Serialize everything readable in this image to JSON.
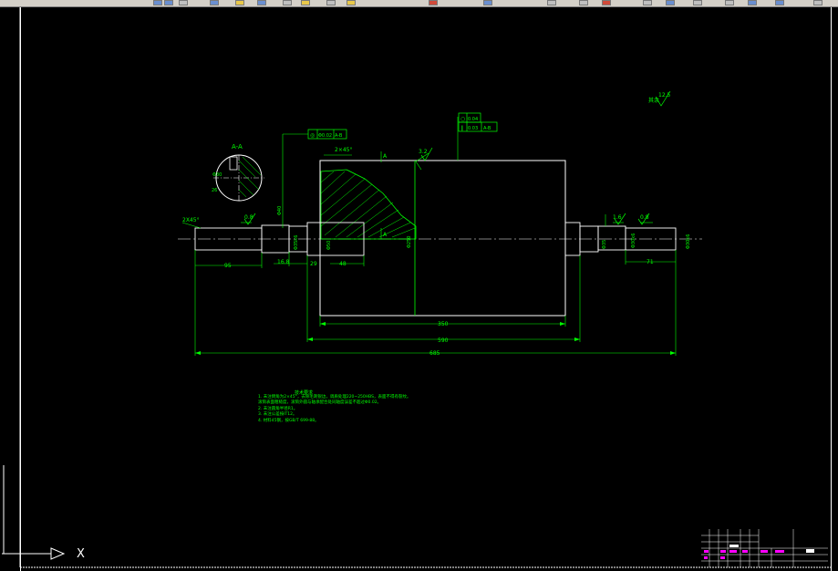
{
  "drawing": {
    "section_label": "A-A",
    "chamfer_left": "2X45°",
    "chamfer_roller": "2×45°",
    "roughness_top": "3.2",
    "roughness_corner": "12.5",
    "roughness_corner_prefix": "其余",
    "roughness_left_journal": "0.8",
    "roughness_right_journal": "0.8",
    "roughness_right_mid": "1.6",
    "section_marker_a_top": "A",
    "section_marker_a_bottom": "A",
    "tolerance_left": {
      "symbol": "◎",
      "value": "Φ0.02",
      "datum": "A-B"
    },
    "tolerance_top_1": {
      "symbol": "○",
      "value": "0.04"
    },
    "tolerance_top_2": {
      "symbol": "∥",
      "value": "0.03",
      "datum": "A-B"
    },
    "dim_95": "95",
    "dim_168": "16.8",
    "dim_29": "29",
    "dim_48": "48",
    "dim_350": "350",
    "dim_590": "590",
    "dim_685": "685",
    "dim_71": "71",
    "dim_roller_dia": "Φ250",
    "dim_right_end": "Φ30k6",
    "dim_section_dia": "Φ30",
    "dim_section_key": "26",
    "dim_left_shaft": "Φ35k6",
    "dim_left_mid": "Φ40",
    "dim_left_flange": "Φ50",
    "dim_right_mid": "Φ35",
    "dim_right_journal": "Φ30k6"
  },
  "notes": {
    "title": "技术要求",
    "lines": [
      "1. 未注倒角为2×45°，去除毛刺锐边，调质处理220~250HBS，表面不得有裂纹。",
      "   滚筒表面粗糙度，滚筒外圆与轴承配合处同轴度误差不超过Φ0.02。",
      "2. 未注圆角半径R1。",
      "3. 未注公差按IT12。",
      "4. 材料45钢，按GB/T 699-88。"
    ]
  },
  "colors": {
    "background": "#000000",
    "outline": "#ffffff",
    "dimension": "#00ff00",
    "centerline": "#ffffff",
    "hatch": "#00ff00",
    "titleblock_accent": "#ff00ff"
  },
  "toolbar": {
    "icons": [
      "open-icon",
      "save-icon",
      "print-icon",
      "cut-icon",
      "copy-icon",
      "paste-icon",
      "undo-icon",
      "redo-icon",
      "pan-icon",
      "zoom-icon",
      "properties-icon",
      "layer-icon",
      "help-icon"
    ]
  },
  "ucs": {
    "axis_label": "X"
  }
}
